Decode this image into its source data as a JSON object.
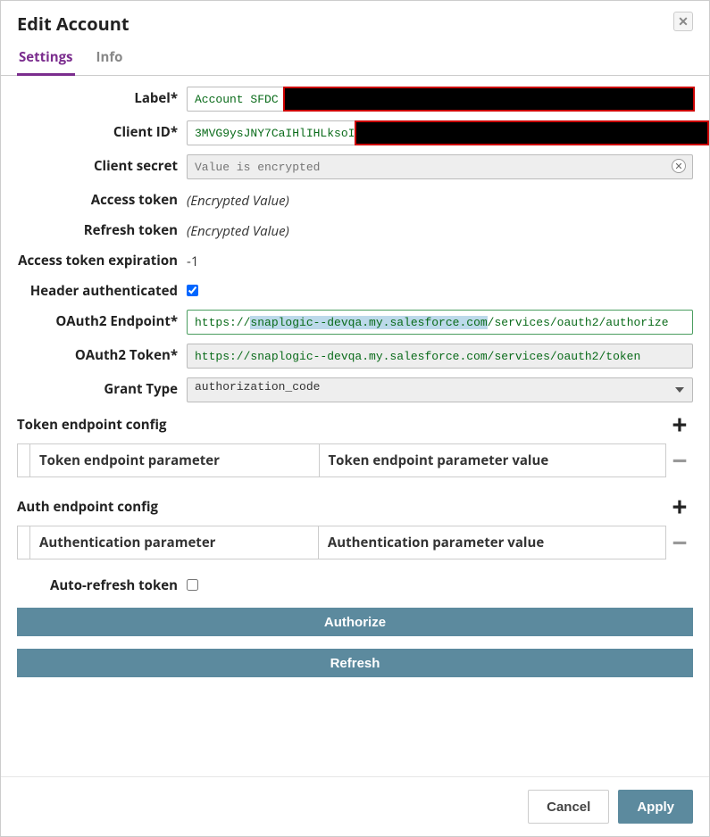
{
  "dialog": {
    "title": "Edit Account"
  },
  "tabs": {
    "settings": "Settings",
    "info": "Info",
    "active": "settings"
  },
  "fields": {
    "label": {
      "label": "Label*",
      "value": "Account SFDC"
    },
    "client_id": {
      "label": "Client ID*",
      "value": "3MVG9ysJNY7CaIHlIHLksoILn"
    },
    "client_secret": {
      "label": "Client secret",
      "placeholder": "Value is encrypted"
    },
    "access_token": {
      "label": "Access token",
      "value": "(Encrypted Value)"
    },
    "refresh_token": {
      "label": "Refresh token",
      "value": "(Encrypted Value)"
    },
    "access_token_exp": {
      "label": "Access token expiration",
      "value": "-1"
    },
    "header_auth": {
      "label": "Header authenticated",
      "checked": true
    },
    "oauth2_endpoint": {
      "label": "OAuth2 Endpoint*",
      "value_pre": "https://",
      "value_host": "snaplogic--devqa.my.salesforce.com",
      "value_post": "/services/oauth2/authorize"
    },
    "oauth2_token": {
      "label": "OAuth2 Token*",
      "value": "https://snaplogic--devqa.my.salesforce.com/services/oauth2/token"
    },
    "grant_type": {
      "label": "Grant Type",
      "value": "authorization_code"
    },
    "auto_refresh": {
      "label": "Auto-refresh token",
      "checked": false
    }
  },
  "token_config": {
    "title": "Token endpoint config",
    "col1": "Token endpoint parameter",
    "col2": "Token endpoint parameter value"
  },
  "auth_config": {
    "title": "Auth endpoint config",
    "col1": "Authentication parameter",
    "col2": "Authentication parameter value"
  },
  "buttons": {
    "authorize": "Authorize",
    "refresh": "Refresh",
    "cancel": "Cancel",
    "apply": "Apply"
  }
}
